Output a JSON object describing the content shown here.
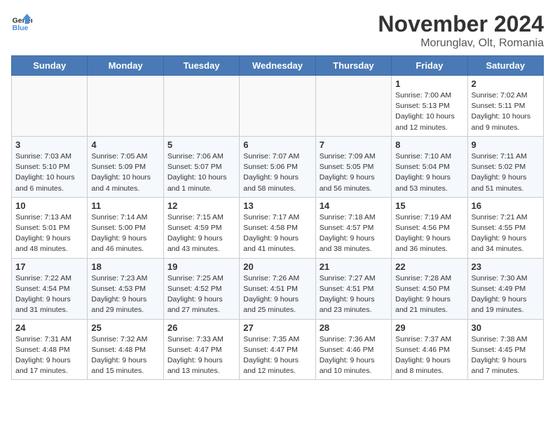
{
  "logo": {
    "general": "General",
    "blue": "Blue"
  },
  "title": "November 2024",
  "subtitle": "Morunglav, Olt, Romania",
  "weekdays": [
    "Sunday",
    "Monday",
    "Tuesday",
    "Wednesday",
    "Thursday",
    "Friday",
    "Saturday"
  ],
  "weeks": [
    [
      {
        "day": "",
        "info": ""
      },
      {
        "day": "",
        "info": ""
      },
      {
        "day": "",
        "info": ""
      },
      {
        "day": "",
        "info": ""
      },
      {
        "day": "",
        "info": ""
      },
      {
        "day": "1",
        "info": "Sunrise: 7:00 AM\nSunset: 5:13 PM\nDaylight: 10 hours and 12 minutes."
      },
      {
        "day": "2",
        "info": "Sunrise: 7:02 AM\nSunset: 5:11 PM\nDaylight: 10 hours and 9 minutes."
      }
    ],
    [
      {
        "day": "3",
        "info": "Sunrise: 7:03 AM\nSunset: 5:10 PM\nDaylight: 10 hours and 6 minutes."
      },
      {
        "day": "4",
        "info": "Sunrise: 7:05 AM\nSunset: 5:09 PM\nDaylight: 10 hours and 4 minutes."
      },
      {
        "day": "5",
        "info": "Sunrise: 7:06 AM\nSunset: 5:07 PM\nDaylight: 10 hours and 1 minute."
      },
      {
        "day": "6",
        "info": "Sunrise: 7:07 AM\nSunset: 5:06 PM\nDaylight: 9 hours and 58 minutes."
      },
      {
        "day": "7",
        "info": "Sunrise: 7:09 AM\nSunset: 5:05 PM\nDaylight: 9 hours and 56 minutes."
      },
      {
        "day": "8",
        "info": "Sunrise: 7:10 AM\nSunset: 5:04 PM\nDaylight: 9 hours and 53 minutes."
      },
      {
        "day": "9",
        "info": "Sunrise: 7:11 AM\nSunset: 5:02 PM\nDaylight: 9 hours and 51 minutes."
      }
    ],
    [
      {
        "day": "10",
        "info": "Sunrise: 7:13 AM\nSunset: 5:01 PM\nDaylight: 9 hours and 48 minutes."
      },
      {
        "day": "11",
        "info": "Sunrise: 7:14 AM\nSunset: 5:00 PM\nDaylight: 9 hours and 46 minutes."
      },
      {
        "day": "12",
        "info": "Sunrise: 7:15 AM\nSunset: 4:59 PM\nDaylight: 9 hours and 43 minutes."
      },
      {
        "day": "13",
        "info": "Sunrise: 7:17 AM\nSunset: 4:58 PM\nDaylight: 9 hours and 41 minutes."
      },
      {
        "day": "14",
        "info": "Sunrise: 7:18 AM\nSunset: 4:57 PM\nDaylight: 9 hours and 38 minutes."
      },
      {
        "day": "15",
        "info": "Sunrise: 7:19 AM\nSunset: 4:56 PM\nDaylight: 9 hours and 36 minutes."
      },
      {
        "day": "16",
        "info": "Sunrise: 7:21 AM\nSunset: 4:55 PM\nDaylight: 9 hours and 34 minutes."
      }
    ],
    [
      {
        "day": "17",
        "info": "Sunrise: 7:22 AM\nSunset: 4:54 PM\nDaylight: 9 hours and 31 minutes."
      },
      {
        "day": "18",
        "info": "Sunrise: 7:23 AM\nSunset: 4:53 PM\nDaylight: 9 hours and 29 minutes."
      },
      {
        "day": "19",
        "info": "Sunrise: 7:25 AM\nSunset: 4:52 PM\nDaylight: 9 hours and 27 minutes."
      },
      {
        "day": "20",
        "info": "Sunrise: 7:26 AM\nSunset: 4:51 PM\nDaylight: 9 hours and 25 minutes."
      },
      {
        "day": "21",
        "info": "Sunrise: 7:27 AM\nSunset: 4:51 PM\nDaylight: 9 hours and 23 minutes."
      },
      {
        "day": "22",
        "info": "Sunrise: 7:28 AM\nSunset: 4:50 PM\nDaylight: 9 hours and 21 minutes."
      },
      {
        "day": "23",
        "info": "Sunrise: 7:30 AM\nSunset: 4:49 PM\nDaylight: 9 hours and 19 minutes."
      }
    ],
    [
      {
        "day": "24",
        "info": "Sunrise: 7:31 AM\nSunset: 4:48 PM\nDaylight: 9 hours and 17 minutes."
      },
      {
        "day": "25",
        "info": "Sunrise: 7:32 AM\nSunset: 4:48 PM\nDaylight: 9 hours and 15 minutes."
      },
      {
        "day": "26",
        "info": "Sunrise: 7:33 AM\nSunset: 4:47 PM\nDaylight: 9 hours and 13 minutes."
      },
      {
        "day": "27",
        "info": "Sunrise: 7:35 AM\nSunset: 4:47 PM\nDaylight: 9 hours and 12 minutes."
      },
      {
        "day": "28",
        "info": "Sunrise: 7:36 AM\nSunset: 4:46 PM\nDaylight: 9 hours and 10 minutes."
      },
      {
        "day": "29",
        "info": "Sunrise: 7:37 AM\nSunset: 4:46 PM\nDaylight: 9 hours and 8 minutes."
      },
      {
        "day": "30",
        "info": "Sunrise: 7:38 AM\nSunset: 4:45 PM\nDaylight: 9 hours and 7 minutes."
      }
    ]
  ]
}
